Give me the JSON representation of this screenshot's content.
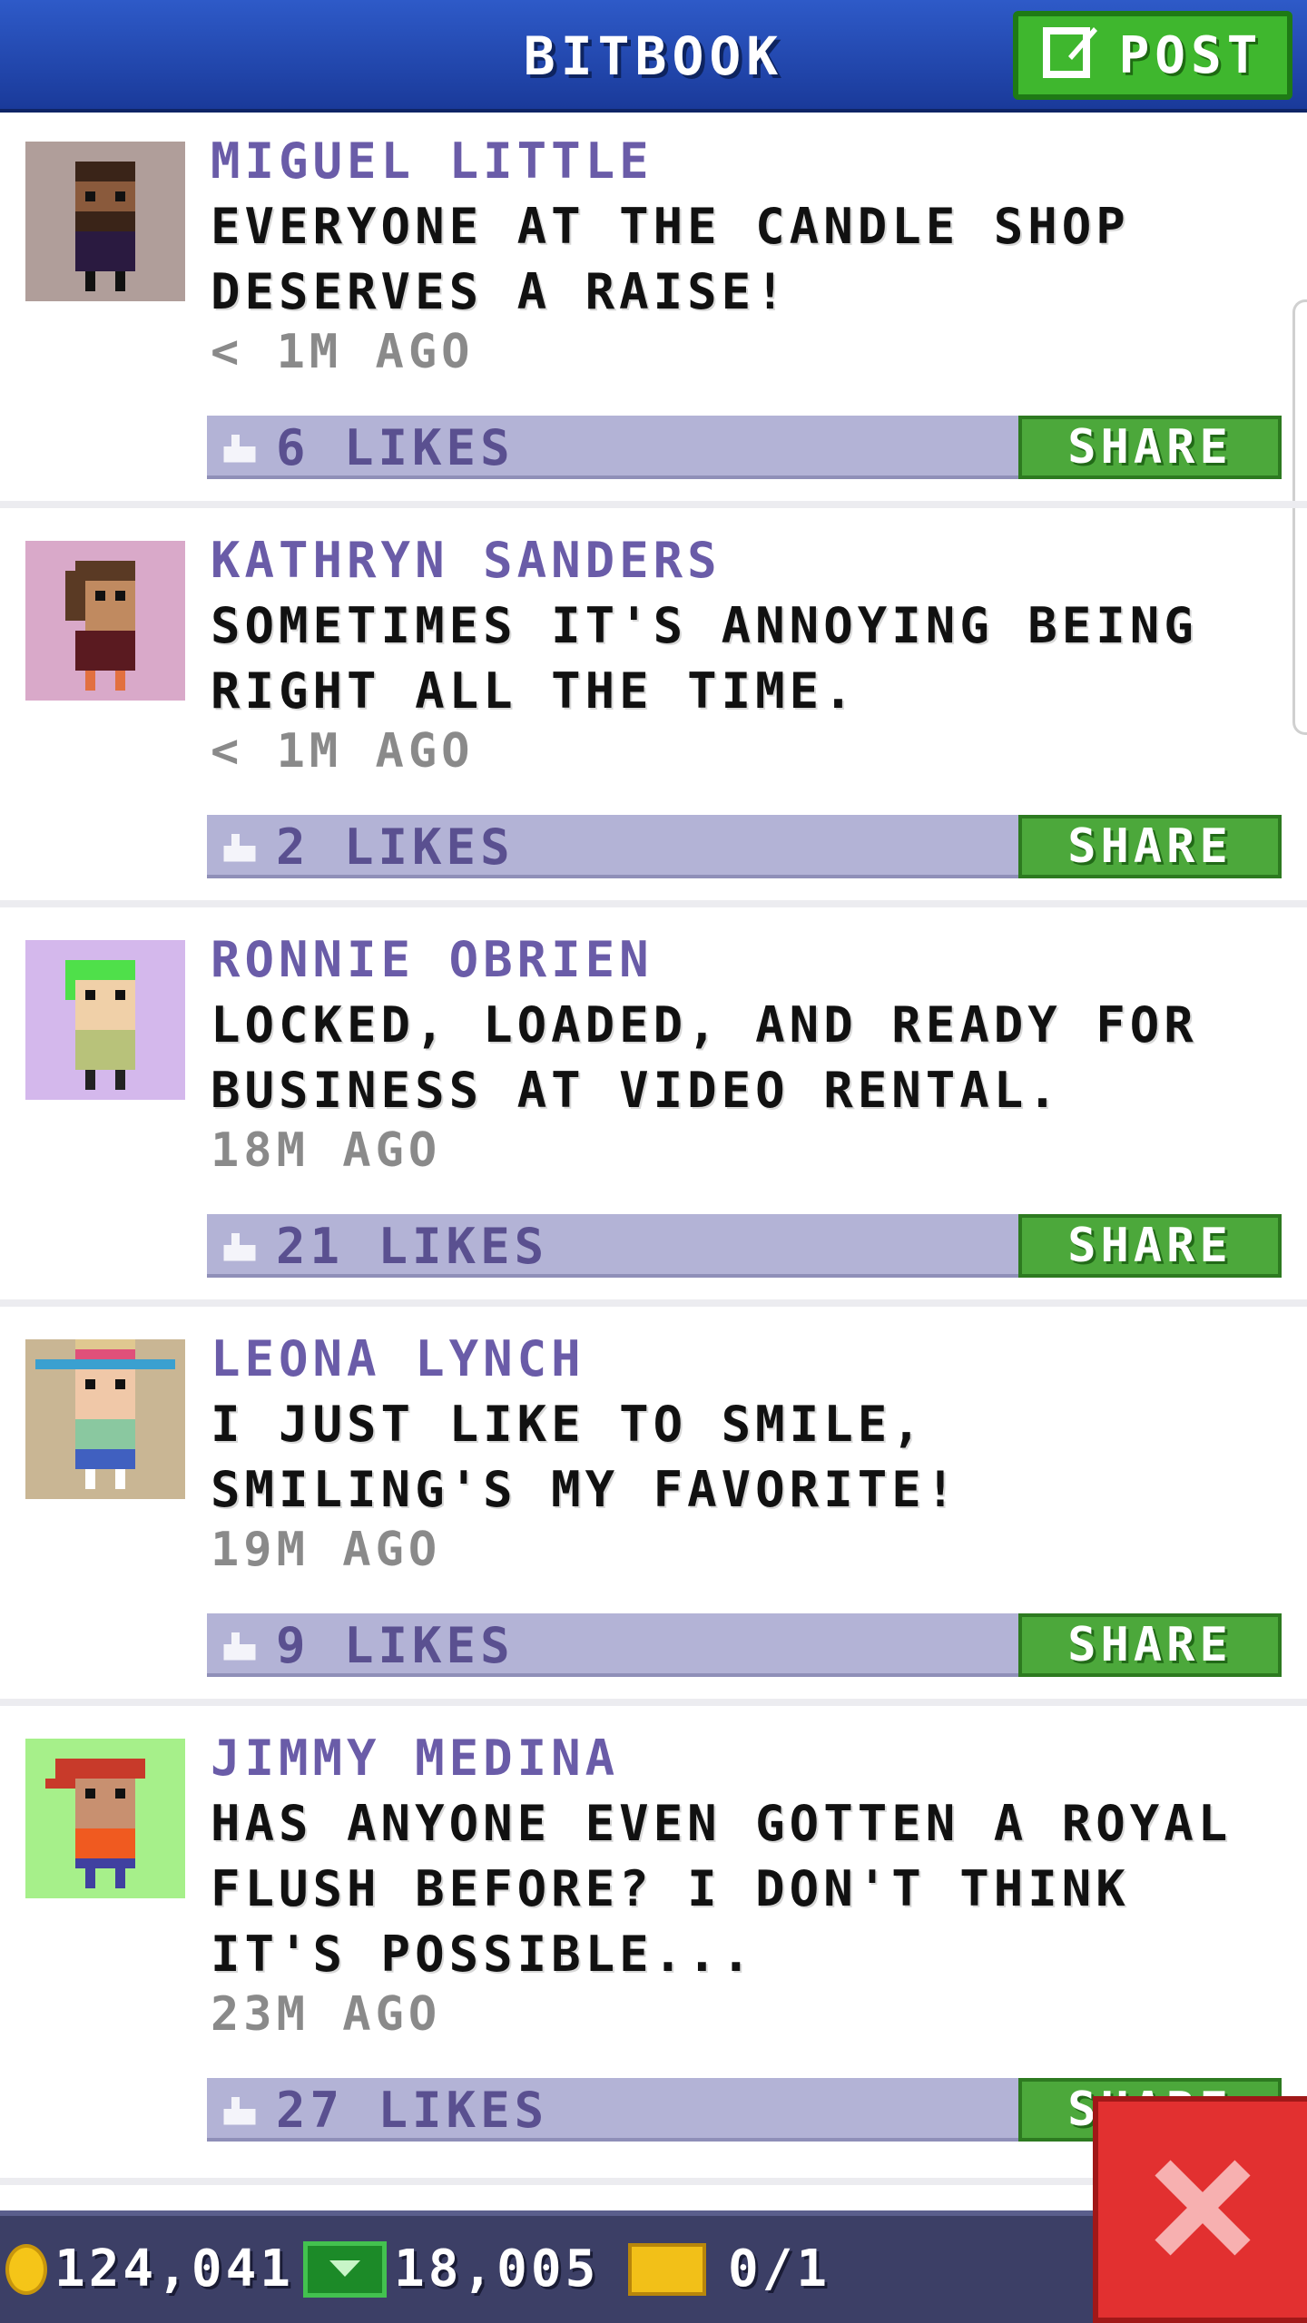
{
  "header": {
    "title": "BITBOOK",
    "post_label": "POST"
  },
  "posts": [
    {
      "name": "MIGUEL LITTLE",
      "message": "EVERYONE AT THE CANDLE SHOP DESERVES A RAISE!",
      "time": "< 1M AGO",
      "likes": "6 LIKES",
      "share": "SHARE",
      "avatar_bg": "#b09e9a"
    },
    {
      "name": "KATHRYN SANDERS",
      "message": "SOMETIMES IT'S ANNOYING BEING RIGHT ALL THE TIME.",
      "time": "< 1M AGO",
      "likes": "2 LIKES",
      "share": "SHARE",
      "avatar_bg": "#d9a9c9"
    },
    {
      "name": "RONNIE OBRIEN",
      "message": "LOCKED, LOADED, AND READY FOR BUSINESS AT VIDEO RENTAL.",
      "time": "18M AGO",
      "likes": "21 LIKES",
      "share": "SHARE",
      "avatar_bg": "#d4b8ec"
    },
    {
      "name": "LEONA LYNCH",
      "message": "I JUST LIKE TO SMILE, SMILING'S MY FAVORITE!",
      "time": "19M AGO",
      "likes": "9 LIKES",
      "share": "SHARE",
      "avatar_bg": "#c9b694"
    },
    {
      "name": "JIMMY MEDINA",
      "message": "HAS ANYONE EVEN GOTTEN A ROYAL FLUSH BEFORE? I DON'T THINK IT'S POSSIBLE...",
      "time": "23M AGO",
      "likes": "27 LIKES",
      "share": "SHARE",
      "avatar_bg": "#a6f08a"
    }
  ],
  "status_bar": {
    "coins": "124,041",
    "bux": "18,005",
    "tickets": "0/1"
  },
  "colors": {
    "header": "#1f44b0",
    "post_button": "#3fb72e",
    "likes_bar": "#b3b3d6",
    "share_button": "#4ca83b",
    "close_button": "#e23030"
  },
  "icons": {
    "post": "edit-icon",
    "like": "thumbs-up-icon",
    "coin": "coin-icon",
    "bux": "cash-icon",
    "ticket": "ticket-icon",
    "close": "close-icon"
  }
}
